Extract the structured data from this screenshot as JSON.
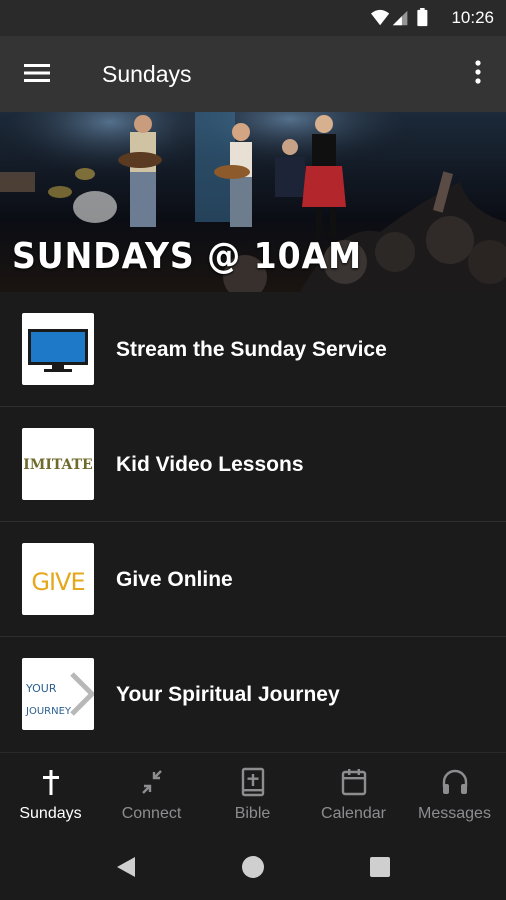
{
  "status_bar": {
    "time": "10:26"
  },
  "app_bar": {
    "title": "Sundays"
  },
  "hero": {
    "caption": "SUNDAYS @ 10AM"
  },
  "list": [
    {
      "label": "Stream the Sunday Service",
      "icon": "monitor-icon"
    },
    {
      "label": "Kid Video Lessons",
      "icon": "imitate-logo",
      "thumb_text": "IMITATE"
    },
    {
      "label": "Give Online",
      "icon": "give-logo",
      "thumb_text": "GIVE"
    },
    {
      "label": "Your Spiritual Journey",
      "icon": "your-journey-logo",
      "thumb_text_1": "YOUR",
      "thumb_text_2": "JOURNEY"
    }
  ],
  "bottom_nav": [
    {
      "label": "Sundays",
      "icon": "cross-icon",
      "active": true
    },
    {
      "label": "Connect",
      "icon": "collapse-arrows-icon",
      "active": false
    },
    {
      "label": "Bible",
      "icon": "bible-icon",
      "active": false
    },
    {
      "label": "Calendar",
      "icon": "calendar-icon",
      "active": false
    },
    {
      "label": "Messages",
      "icon": "headphones-icon",
      "active": false
    }
  ],
  "colors": {
    "app_bar": "#343435",
    "background": "#1b1b1c",
    "active": "#ffffff",
    "inactive": "#8d8d8f",
    "give_yellow": "#e5a81c",
    "imitate_olive": "#6f6a2c"
  }
}
